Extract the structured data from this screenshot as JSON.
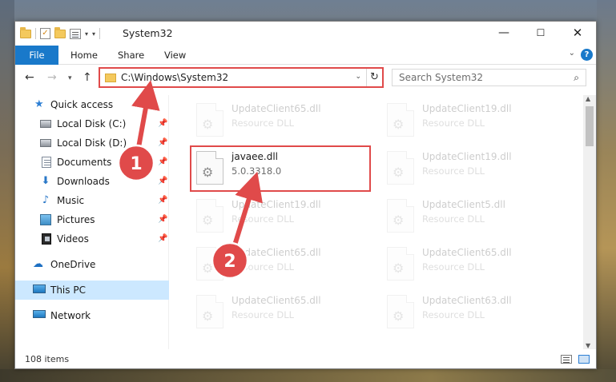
{
  "window": {
    "title": "System32",
    "controls": {
      "minimize": "—",
      "maximize": "☐",
      "close": "✕"
    }
  },
  "ribbon": {
    "file": "File",
    "tabs": [
      "Home",
      "Share",
      "View"
    ],
    "help": "?"
  },
  "navigation": {
    "address_path": "C:\\Windows\\System32",
    "search_placeholder": "Search System32"
  },
  "sidebar": {
    "items": [
      {
        "label": "Quick access",
        "icon": "star-icon",
        "pinned": false
      },
      {
        "label": "Local Disk (C:)",
        "icon": "disk-icon",
        "pinned": true
      },
      {
        "label": "Local Disk (D:)",
        "icon": "disk-icon",
        "pinned": true
      },
      {
        "label": "Documents",
        "icon": "documents-icon",
        "pinned": true
      },
      {
        "label": "Downloads",
        "icon": "download-icon",
        "pinned": true
      },
      {
        "label": "Music",
        "icon": "music-icon",
        "pinned": true
      },
      {
        "label": "Pictures",
        "icon": "pictures-icon",
        "pinned": true
      },
      {
        "label": "Videos",
        "icon": "videos-icon",
        "pinned": true
      },
      {
        "label": "OneDrive",
        "icon": "cloud-icon",
        "pinned": false
      },
      {
        "label": "This PC",
        "icon": "computer-icon",
        "pinned": false,
        "selected": true
      },
      {
        "label": "Network",
        "icon": "network-icon",
        "pinned": false
      }
    ]
  },
  "files": {
    "highlighted": {
      "name": "javaee.dll",
      "subtitle": "5.0.3318.0"
    },
    "items": [
      {
        "name": "UpdateClient65.dll",
        "subtitle": "Resource DLL"
      },
      {
        "name": "UpdateClient19.dll",
        "subtitle": "Resource DLL"
      },
      {
        "name": "UpdateClient19.dll",
        "subtitle": "Resource DLL"
      },
      {
        "name": "UpdateClient19.dll",
        "subtitle": "Resource DLL"
      },
      {
        "name": "UpdateClient5.dll",
        "subtitle": "Resource DLL"
      },
      {
        "name": "UpdateClient65.dll",
        "subtitle": "Resource DLL"
      },
      {
        "name": "UpdateClient65.dll",
        "subtitle": "Resource DLL"
      },
      {
        "name": "UpdateClient65.dll",
        "subtitle": "Resource DLL"
      },
      {
        "name": "UpdateClient63.dll",
        "subtitle": "Resource DLL"
      }
    ]
  },
  "status": {
    "item_count": "108 items"
  },
  "annotations": {
    "step1": "1",
    "step2": "2",
    "color": "#e04a4a"
  }
}
